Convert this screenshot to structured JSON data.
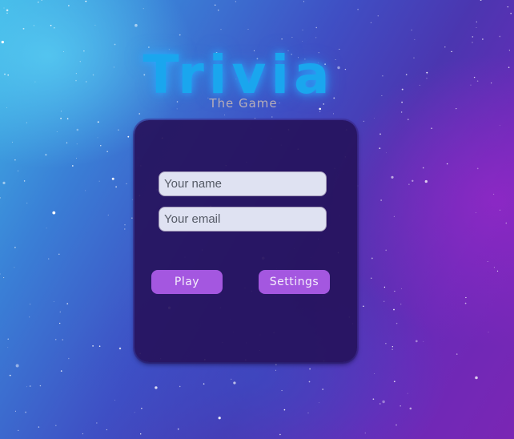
{
  "app": {
    "title": "Trivia",
    "subtitle": "The Game"
  },
  "form": {
    "name_placeholder": "Your name",
    "email_placeholder": "Your email",
    "name_value": "",
    "email_value": ""
  },
  "actions": {
    "play_label": "Play",
    "settings_label": "Settings"
  },
  "colors": {
    "title": "#1aa6ee",
    "card": "#26125c",
    "button": "#a457e0",
    "input_bg": "#dfe2f2"
  }
}
